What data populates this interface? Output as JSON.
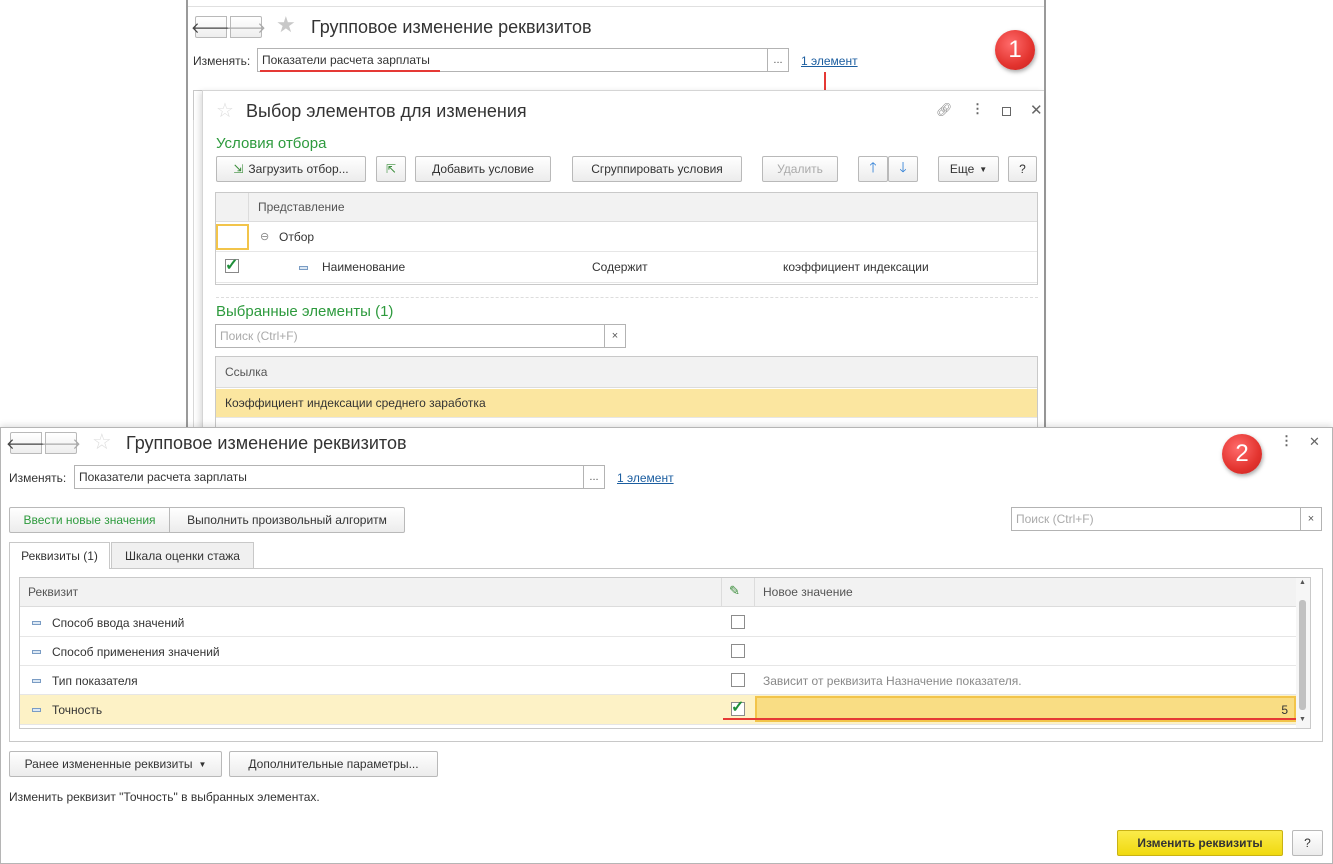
{
  "dialog1": {
    "title": "Групповое изменение реквизитов",
    "change_label": "Изменять:",
    "change_value": "Показатели расчета зарплаты",
    "elements_link": "1 элемент",
    "badge": "1"
  },
  "select_dialog": {
    "title": "Выбор элементов для изменения",
    "conditions_heading": "Условия отбора",
    "toolbar": {
      "load_filter": "Загрузить отбор...",
      "add_condition": "Добавить условие",
      "group_conditions": "Сгруппировать условия",
      "delete": "Удалить",
      "more": "Еще",
      "help": "?"
    },
    "filter_table": {
      "header": "Представление",
      "group_row": "Отбор",
      "condition": {
        "field": "Наименование",
        "operator": "Содержит",
        "value": "коэффициент индексации",
        "checked": true
      }
    },
    "selected_heading": "Выбранные элементы (1)",
    "search_placeholder": "Поиск (Ctrl+F)",
    "selected_table": {
      "header": "Ссылка",
      "rows": [
        "Коэффициент индексации среднего заработка"
      ]
    }
  },
  "main": {
    "title": "Групповое изменение реквизитов",
    "change_label": "Изменять:",
    "change_value": "Показатели расчета зарплаты",
    "elements_link": "1 элемент",
    "badge": "2",
    "mode_buttons": [
      "Ввести новые значения",
      "Выполнить произвольный алгоритм"
    ],
    "search_placeholder": "Поиск (Ctrl+F)",
    "tabs": [
      "Реквизиты (1)",
      "Шкала оценки стажа"
    ],
    "table": {
      "col_attr": "Реквизит",
      "col_value": "Новое значение",
      "rows": [
        {
          "name": "Способ ввода значений",
          "checked": false,
          "value": ""
        },
        {
          "name": "Способ применения значений",
          "checked": false,
          "value": ""
        },
        {
          "name": "Тип показателя",
          "checked": false,
          "value": "Зависит от реквизита Назначение показателя."
        },
        {
          "name": "Точность",
          "checked": true,
          "value": "5"
        }
      ]
    },
    "prev_changed_button": "Ранее измененные реквизиты",
    "extra_params_button": "Дополнительные параметры...",
    "status_text": "Изменить реквизит \"Точность\" в выбранных элементах.",
    "apply_button": "Изменить реквизиты",
    "help_button": "?"
  },
  "colors": {
    "accent_green": "#2d9a3d",
    "selection_yellow": "#fbe6a0",
    "primary_button": "#f5e01a",
    "badge_red": "#e3342f",
    "link_blue": "#1c5ea0"
  }
}
